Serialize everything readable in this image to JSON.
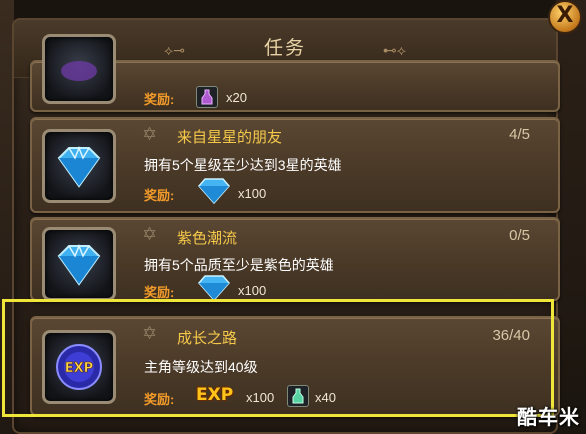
{
  "window": {
    "title": "任务"
  },
  "reward_label": "奖励:",
  "tasks": [
    {
      "name": "",
      "desc": "",
      "progress": "",
      "rewards": [
        {
          "icon": "potion-icon",
          "amount": "x20"
        }
      ]
    },
    {
      "name": "来自星星的朋友",
      "desc": "拥有5个星级至少达到3星的英雄",
      "progress": "4/5",
      "icon": "diamond-icon",
      "rewards": [
        {
          "icon": "diamond-icon",
          "amount": "x100"
        }
      ]
    },
    {
      "name": "紫色潮流",
      "desc": "拥有5个品质至少是紫色的英雄",
      "progress": "0/5",
      "icon": "diamond-icon",
      "rewards": [
        {
          "icon": "diamond-icon",
          "amount": "x100"
        }
      ]
    },
    {
      "name": "成长之路",
      "desc": "主角等级达到40级",
      "progress": "36/40",
      "icon": "exp-orb-icon",
      "icon_text": "EXP",
      "rewards": [
        {
          "icon": "exp-icon",
          "label": "EXP",
          "amount": "x100"
        },
        {
          "icon": "potion-icon",
          "amount": "x40"
        }
      ]
    }
  ],
  "watermark": "酷车米",
  "colors": {
    "task_name": "#f5c84a",
    "reward_label": "#f39b2a",
    "highlight": "#f0e63a"
  }
}
